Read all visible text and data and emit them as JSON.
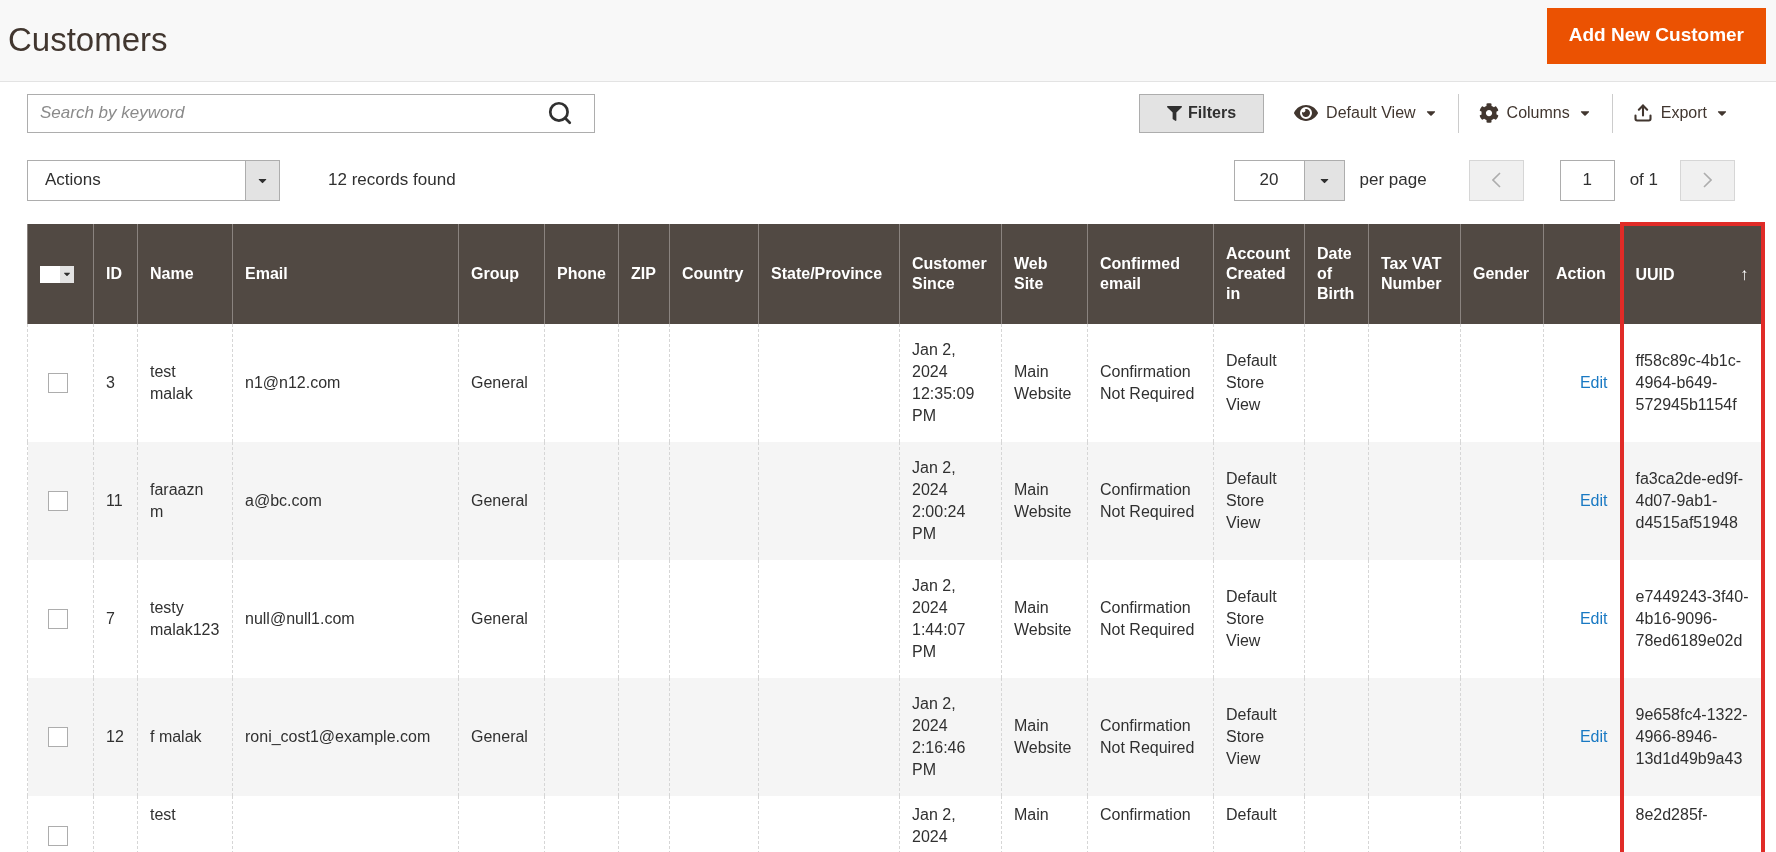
{
  "page_title": "Customers",
  "add_button": "Add New Customer",
  "search": {
    "placeholder": "Search by keyword"
  },
  "toolbar": [
    {
      "kind": "filters",
      "label": "Filters"
    },
    {
      "kind": "view",
      "label": "Default View"
    },
    {
      "kind": "columns",
      "label": "Columns"
    },
    {
      "kind": "export",
      "label": "Export"
    }
  ],
  "actions_select": "Actions",
  "records_found": "12 records found",
  "per_page": {
    "value": "20",
    "label": "per page"
  },
  "pagination": {
    "page": "1",
    "of": "of 1"
  },
  "table": {
    "columns": [
      {
        "kind": "checkbox",
        "highlighted": false
      },
      {
        "kind": "text",
        "label": "ID",
        "highlighted": false
      },
      {
        "kind": "text",
        "label": "Name",
        "highlighted": false
      },
      {
        "kind": "text",
        "label": "Email",
        "highlighted": false
      },
      {
        "kind": "text",
        "label": "Group",
        "highlighted": false
      },
      {
        "kind": "text",
        "label": "Phone",
        "highlighted": false
      },
      {
        "kind": "text",
        "label": "ZIP",
        "highlighted": false
      },
      {
        "kind": "text",
        "label": "Country",
        "highlighted": false
      },
      {
        "kind": "text",
        "label": "State/Province",
        "highlighted": false
      },
      {
        "kind": "text",
        "label": "Customer Since",
        "highlighted": false
      },
      {
        "kind": "text",
        "label": "Web Site",
        "highlighted": false
      },
      {
        "kind": "text",
        "label": "Confirmed email",
        "highlighted": false
      },
      {
        "kind": "text",
        "label": "Account Created in",
        "highlighted": false
      },
      {
        "kind": "text",
        "label": "Date of Birth",
        "highlighted": false
      },
      {
        "kind": "text",
        "label": "Tax VAT Number",
        "highlighted": false
      },
      {
        "kind": "text",
        "label": "Gender",
        "highlighted": false
      },
      {
        "kind": "link",
        "label": "Action",
        "highlighted": false
      },
      {
        "kind": "text",
        "label": "UUID",
        "highlighted": true,
        "sort_indicator": "↑"
      }
    ],
    "rows": [
      {
        "selected": false,
        "cells": [
          null,
          "3",
          "test malak",
          "n1@n12.com",
          "General",
          null,
          null,
          null,
          null,
          "Jan 2, 2024 12:35:09 PM",
          "Main Website",
          "Confirmation Not Required",
          "Default Store View",
          null,
          null,
          null,
          "Edit",
          "ff58c89c-4b1c-4964-b649-572945b1154f"
        ]
      },
      {
        "selected": false,
        "cells": [
          null,
          "11",
          "faraazn m",
          "a@bc.com",
          "General",
          null,
          null,
          null,
          null,
          "Jan 2, 2024 2:00:24 PM",
          "Main Website",
          "Confirmation Not Required",
          "Default Store View",
          null,
          null,
          null,
          "Edit",
          "fa3ca2de-ed9f-4d07-9ab1-d4515af51948"
        ]
      },
      {
        "selected": false,
        "cells": [
          null,
          "7",
          "testy malak123",
          "null@null1.com",
          "General",
          null,
          null,
          null,
          null,
          "Jan 2, 2024 1:44:07 PM",
          "Main Website",
          "Confirmation Not Required",
          "Default Store View",
          null,
          null,
          null,
          "Edit",
          "e7449243-3f40-4b16-9096-78ed6189e02d"
        ]
      },
      {
        "selected": false,
        "cells": [
          null,
          "12",
          "f malak",
          "roni_cost1@example.com",
          "General",
          null,
          null,
          null,
          null,
          "Jan 2, 2024 2:16:46 PM",
          "Main Website",
          "Confirmation Not Required",
          "Default Store View",
          null,
          null,
          null,
          "Edit",
          "9e658fc4-1322-4966-8946-13d1d49b9a43"
        ]
      },
      {
        "selected": false,
        "cells": [
          null,
          null,
          "test",
          null,
          null,
          null,
          null,
          null,
          null,
          "Jan 2, 2024",
          "Main",
          "Confirmation",
          "Default",
          null,
          null,
          null,
          null,
          "8e2d285f-"
        ]
      }
    ]
  }
}
